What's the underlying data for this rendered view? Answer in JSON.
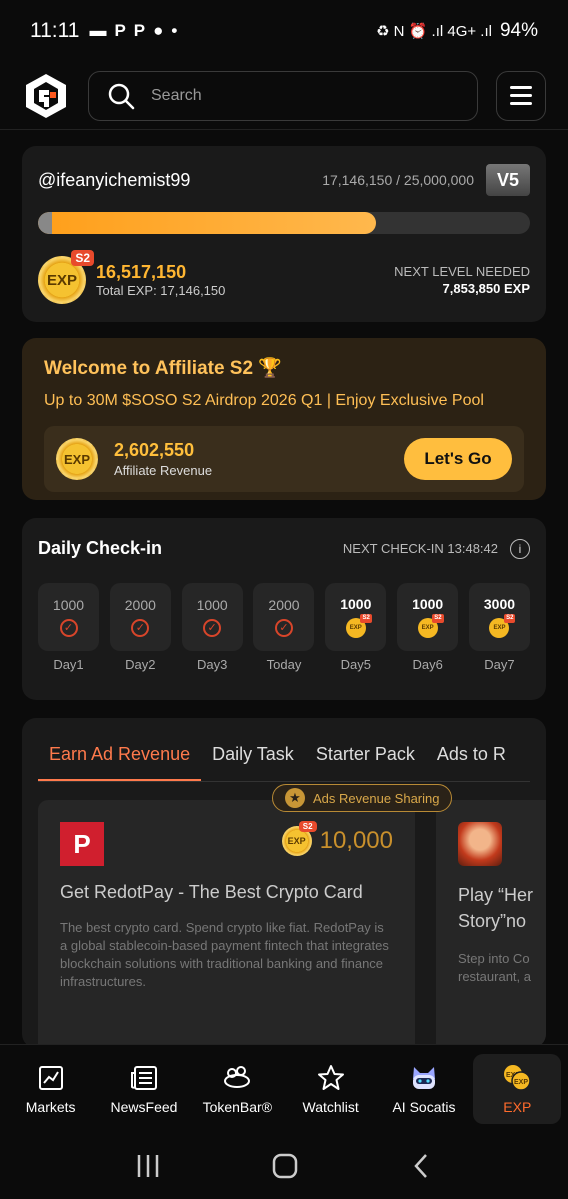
{
  "status": {
    "time": "11:11",
    "left_icons": [
      "▬",
      "P",
      "P",
      "●",
      "•"
    ],
    "right_icons": "♻ N ⏰ .ıl 4G+ .ıl",
    "battery": "94%"
  },
  "header": {
    "search_placeholder": "Search"
  },
  "profile": {
    "username": "@ifeanyichemist99",
    "progress_text": "17,146,150 / 25,000,000",
    "level_badge": "V5",
    "progress_fraction": 0.686,
    "season_tag": "S2",
    "coin_text": "EXP",
    "exp_value": "16,517,150",
    "total_exp": "Total EXP: 17,146,150",
    "next_level_label": "NEXT LEVEL NEEDED",
    "next_level_value": "7,853,850 EXP"
  },
  "affiliate": {
    "title": "Welcome to Affiliate S2 🏆",
    "subtitle": "Up to 30M $SOSO S2 Airdrop 2026 Q1 | Enjoy Exclusive Pool",
    "coin_text": "EXP",
    "revenue_value": "2,602,550",
    "revenue_label": "Affiliate Revenue",
    "button_label": "Let's Go"
  },
  "checkin": {
    "title": "Daily Check-in",
    "next_checkin": "NEXT CHECK-IN 13:48:42",
    "days": [
      {
        "amount": "1000",
        "label": "Day1"
      },
      {
        "amount": "2000",
        "label": "Day2"
      },
      {
        "amount": "1000",
        "label": "Day3"
      },
      {
        "amount": "2000",
        "label": "Today"
      },
      {
        "amount": "1000",
        "label": "Day5"
      },
      {
        "amount": "1000",
        "label": "Day6"
      },
      {
        "amount": "3000",
        "label": "Day7"
      }
    ]
  },
  "earn": {
    "tabs": [
      "Earn Ad Revenue",
      "Daily Task",
      "Starter Pack",
      "Ads to R"
    ],
    "share_badge": "Ads Revenue Sharing",
    "cards": [
      {
        "logo": "P",
        "reward": "10,000",
        "reward_tag": "S2",
        "coin_text": "EXP",
        "title": "Get RedotPay - The Best Crypto Card",
        "desc": "The best crypto card. Spend crypto like fiat. RedotPay is a global stablecoin-based payment fintech that integrates blockchain solutions with traditional banking and finance infrastructures."
      },
      {
        "title_line1": "Play “Her",
        "title_line2": "Story”no",
        "desc_line1": "Step into Co",
        "desc_line2": "restaurant, a"
      }
    ]
  },
  "bottom_nav": [
    {
      "label": "Markets",
      "icon": "chart-icon"
    },
    {
      "label": "NewsFeed",
      "icon": "newspaper-icon"
    },
    {
      "label": "TokenBar®",
      "icon": "tokenbar-icon"
    },
    {
      "label": "Watchlist",
      "icon": "star-icon"
    },
    {
      "label": "AI Socatis",
      "icon": "robot-icon"
    },
    {
      "label": "EXP",
      "icon": "exp-coins-icon",
      "active": true
    }
  ],
  "colors": {
    "accent": "#ff7a4c",
    "gold": "#ffbe3e",
    "background": "#0b0b0b",
    "card": "#1a1a1a"
  }
}
